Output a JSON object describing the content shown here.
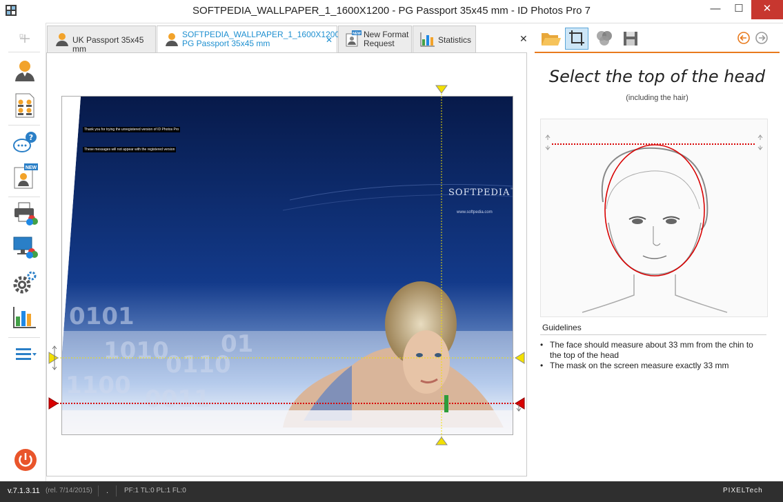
{
  "window": {
    "title": "SOFTPEDIA_WALLPAPER_1_1600X1200 - PG Passport 35x45 mm - ID Photos Pro 7",
    "controls": {
      "minimize": "—",
      "maximize": "☐",
      "close": "✕"
    }
  },
  "tabs": [
    {
      "line1": "UK Passport 35x45 mm",
      "line2": "",
      "icon": "person-icon",
      "active": false
    },
    {
      "line1": "SOFTPEDIA_WALLPAPER_1_1600X1200",
      "line2": "PG Passport 35x45 mm",
      "icon": "person-icon",
      "active": true,
      "close": "✕"
    },
    {
      "line1": "New Format",
      "line2": "Request",
      "icon": "new-format-icon",
      "active": false
    },
    {
      "line1": "Statistics",
      "line2": "",
      "icon": "statistics-icon",
      "active": false
    }
  ],
  "tab_area_close": "✕",
  "sidebar": {
    "items": [
      {
        "icon": "single-person-icon"
      },
      {
        "icon": "group-sheet-icon"
      },
      {
        "icon": "help-chat-icon"
      },
      {
        "icon": "new-person-icon"
      },
      {
        "icon": "print-icon"
      },
      {
        "icon": "monitor-icon"
      },
      {
        "icon": "settings-icon"
      },
      {
        "icon": "chart-icon"
      },
      {
        "icon": "menu-icon"
      }
    ],
    "power_icon": "power-icon"
  },
  "photo": {
    "banner_line1": "Thank you for trying the unregistered version of ID Photos Pro",
    "banner_line2": "These messages will not appear with the registered version",
    "logo": "SOFTPEDIA",
    "logo_tm": "™",
    "url": "www.softpedia.com"
  },
  "right_panel": {
    "tools": [
      "open-folder-icon",
      "crop-icon",
      "color-icon",
      "save-icon"
    ],
    "nav": [
      "back-icon",
      "forward-icon"
    ],
    "instruction_title": "Select the top of the head",
    "instruction_sub": "(including the hair)",
    "guidelines_heading": "Guidelines",
    "guidelines": [
      "The face should measure about 33 mm from the chin to the top of the head",
      "The mask on the screen measure exactly 33 mm"
    ]
  },
  "status": {
    "version": "v.7.1.3.11",
    "release": "(rel. 7/14/2015)",
    "dot": ".",
    "flags": "PF:1 TL:0 PL:1 FL:0",
    "brand": "PIXELTech"
  },
  "colors": {
    "accent": "#e8791c",
    "active_tab": "#1d8fd0",
    "guide_red": "#d80000",
    "marker_yellow": "#f3e000"
  }
}
